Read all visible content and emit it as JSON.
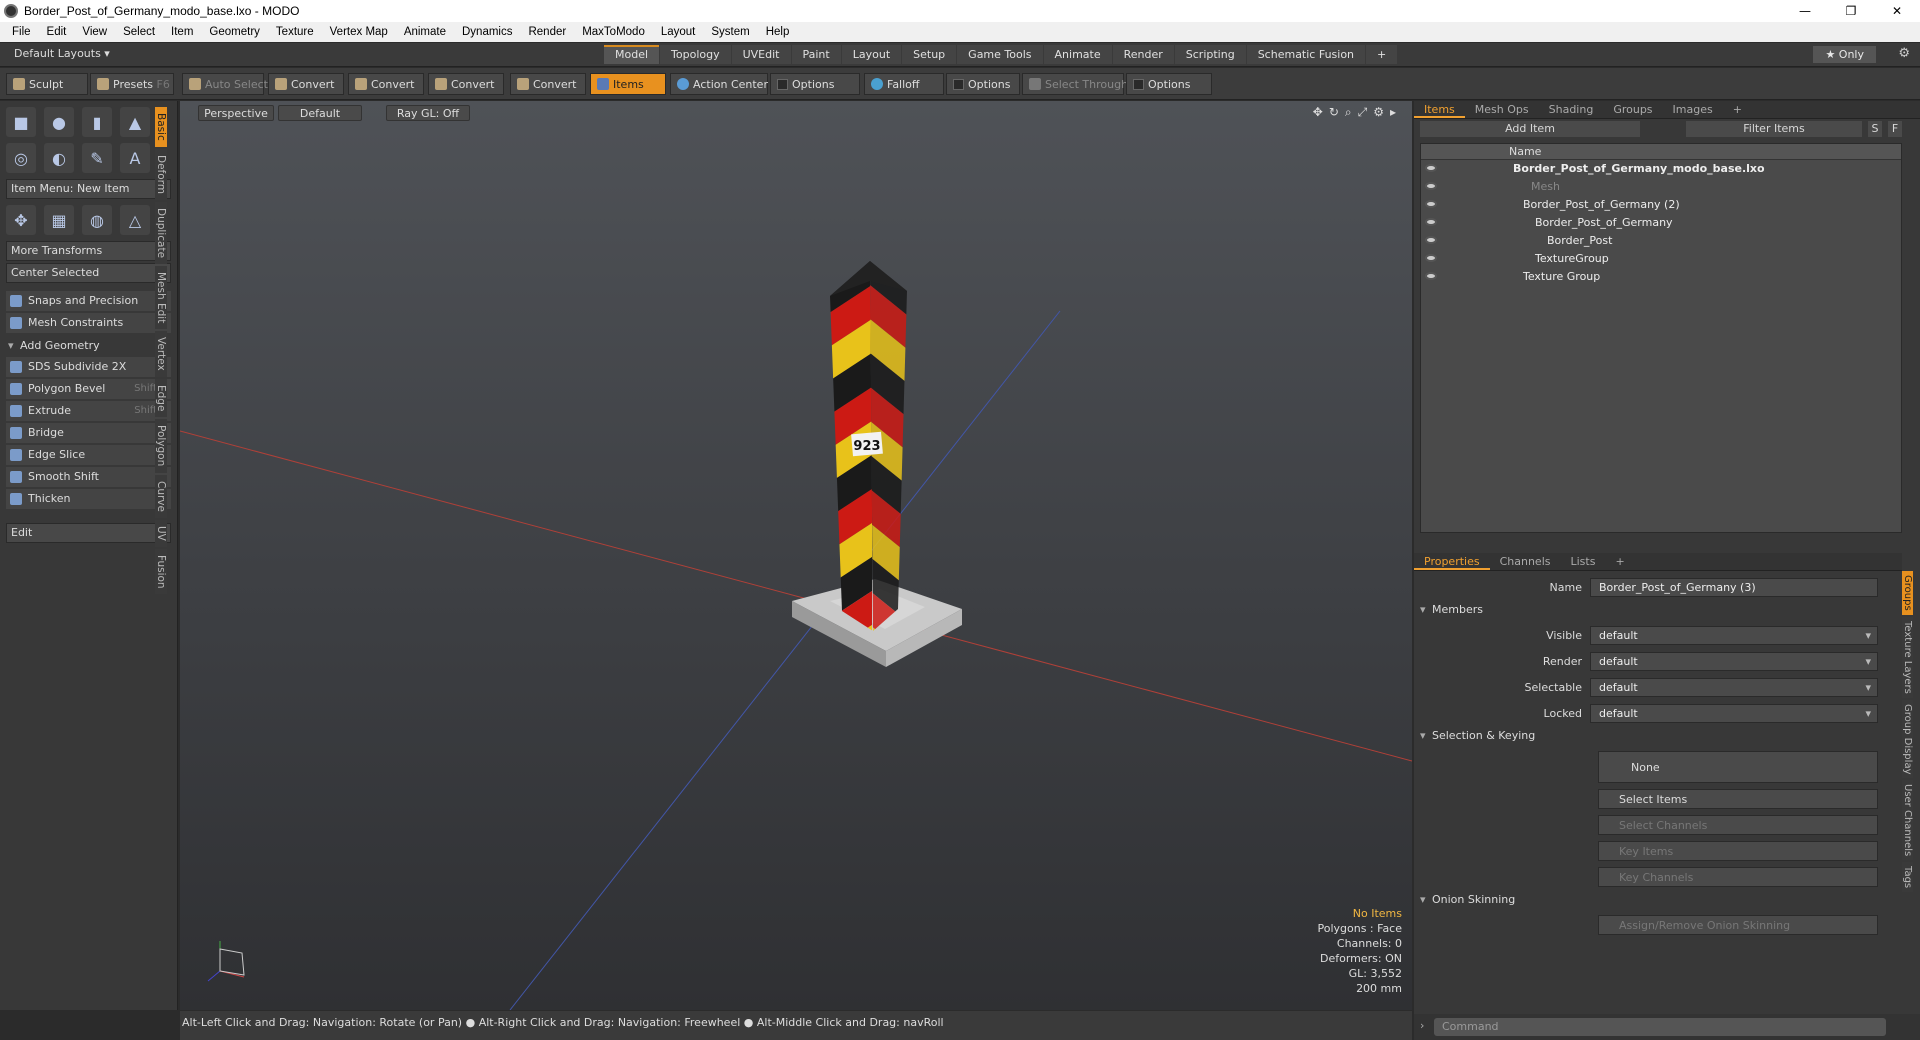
{
  "window": {
    "title": "Border_Post_of_Germany_modo_base.lxo - MODO",
    "min": "—",
    "max": "❐",
    "close": "✕"
  },
  "menu": [
    "File",
    "Edit",
    "View",
    "Select",
    "Item",
    "Geometry",
    "Texture",
    "Vertex Map",
    "Animate",
    "Dynamics",
    "Render",
    "MaxToModo",
    "Layout",
    "System",
    "Help"
  ],
  "layouts": {
    "label": "Default Layouts ▾",
    "tabs": [
      "Model",
      "Topology",
      "UVEdit",
      "Paint",
      "Layout",
      "Setup",
      "Game Tools",
      "Animate",
      "Render",
      "Scripting",
      "Schematic Fusion",
      "+"
    ],
    "active": "Model",
    "only": "★ Only",
    "gear": "⚙"
  },
  "toolbar": {
    "sculpt": "Sculpt",
    "presets": "Presets",
    "presets_key": "F6",
    "auto_select": "Auto Select",
    "convert": "Convert",
    "items": "Items",
    "action_center": "Action Center",
    "options": "Options",
    "falloff": "Falloff",
    "select_through": "Select Through"
  },
  "left": {
    "item_menu": "Item Menu: New Item",
    "more_transforms": "More Transforms",
    "center_selected": "Center Selected",
    "snaps": "Snaps and Precision",
    "mesh_constraints": "Mesh Constraints",
    "add_geometry": "Add Geometry",
    "tools": [
      {
        "label": "SDS Subdivide 2X",
        "key": ""
      },
      {
        "label": "Polygon Bevel",
        "key": "Shift-B"
      },
      {
        "label": "Extrude",
        "key": "Shift-X"
      },
      {
        "label": "Bridge",
        "key": ""
      },
      {
        "label": "Edge Slice",
        "key": ""
      },
      {
        "label": "Smooth Shift",
        "key": ""
      },
      {
        "label": "Thicken",
        "key": ""
      }
    ],
    "edit": "Edit",
    "vtabs": [
      "Basic",
      "Deform",
      "Duplicate",
      "Mesh Edit",
      "Vertex",
      "Edge",
      "Polygon",
      "Curve",
      "UV",
      "Fusion"
    ]
  },
  "viewport": {
    "perspective": "Perspective",
    "default": "Default",
    "raygl": "Ray GL: Off",
    "label923": "923",
    "stats": {
      "no_items": "No Items",
      "polygons": "Polygons : Face",
      "channels": "Channels: 0",
      "deformers": "Deformers: ON",
      "gl": "GL: 3,552",
      "mm": "200 mm"
    }
  },
  "status": "Alt-Left Click and Drag: Navigation: Rotate (or Pan) ● Alt-Right Click and Drag: Navigation: Freewheel ● Alt-Middle Click and Drag: navRoll",
  "items_panel": {
    "tabs": [
      "Items",
      "Mesh Ops",
      "Shading",
      "Groups",
      "Images",
      "+"
    ],
    "add_item": "Add Item",
    "filter": "Filter Items",
    "s": "S",
    "f": "F",
    "name_header": "Name",
    "rows": [
      {
        "label": "Border_Post_of_Germany_modo_base.lxo",
        "style": "bold"
      },
      {
        "label": "Mesh",
        "style": "dim"
      },
      {
        "label": "Border_Post_of_Germany (2)",
        "style": ""
      },
      {
        "label": "Border_Post_of_Germany",
        "style": ""
      },
      {
        "label": "Border_Post",
        "style": ""
      },
      {
        "label": "TextureGroup",
        "style": ""
      },
      {
        "label": "Texture Group",
        "style": ""
      }
    ]
  },
  "props": {
    "tabs": [
      "Properties",
      "Channels",
      "Lists",
      "+"
    ],
    "name_label": "Name",
    "name_value": "Border_Post_of_Germany (3)",
    "members": "Members",
    "fields": [
      {
        "label": "Visible",
        "value": "default"
      },
      {
        "label": "Render",
        "value": "default"
      },
      {
        "label": "Selectable",
        "value": "default"
      },
      {
        "label": "Locked",
        "value": "default"
      }
    ],
    "sel_keying": "Selection & Keying",
    "none": "None",
    "select_items": "Select Items",
    "select_channels": "Select Channels",
    "key_items": "Key Items",
    "key_channels": "Key Channels",
    "onion": "Onion Skinning",
    "assign_onion": "Assign/Remove Onion Skinning",
    "vtabs": [
      "Groups",
      "Texture Layers",
      "Group Display",
      "User Channels",
      "Tags"
    ]
  },
  "command": {
    "placeholder": "Command"
  },
  "colors": {
    "accent": "#e8911f",
    "black": "#1a1a1a",
    "red": "#cc1a14",
    "gold": "#e8c21a"
  }
}
